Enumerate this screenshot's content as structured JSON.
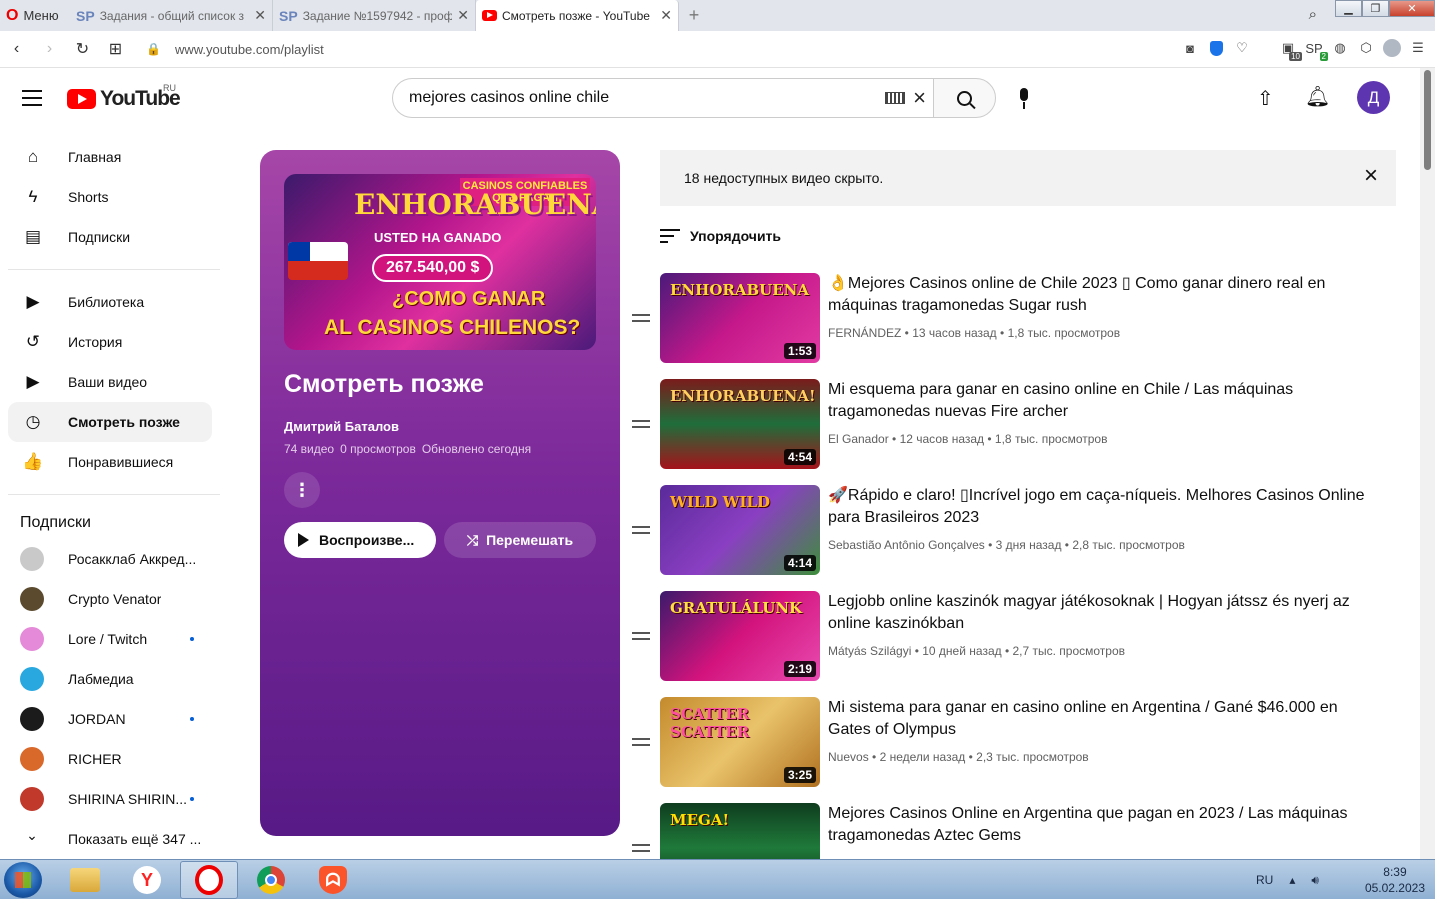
{
  "browser": {
    "menu_label": "Меню",
    "tabs": [
      {
        "title": "Задания - общий список з"
      },
      {
        "title": "Задание №1597942 - проф"
      },
      {
        "title": "Смотреть позже - YouTube"
      }
    ],
    "new_tab": "+",
    "url": "www.youtube.com/playlist",
    "ext_badges": {
      "a": "10",
      "b": "2"
    }
  },
  "youtube": {
    "logo_text": "YouTube",
    "country": "RU",
    "search_value": "mejores casinos online chile",
    "avatar_letter": "Д"
  },
  "sidebar": {
    "items": [
      {
        "label": "Главная",
        "icon": "⌂"
      },
      {
        "label": "Shorts",
        "icon": "ϟ"
      },
      {
        "label": "Подписки",
        "icon": "▤"
      }
    ],
    "items2": [
      {
        "label": "Библиотека",
        "icon": "▶"
      },
      {
        "label": "История",
        "icon": "↺"
      },
      {
        "label": "Ваши видео",
        "icon": "▶"
      },
      {
        "label": "Смотреть позже",
        "icon": "◷"
      },
      {
        "label": "Понравившиеся",
        "icon": "👍"
      }
    ],
    "subs_heading": "Подписки",
    "subscriptions": [
      {
        "name": "Росакклаб Аккред...",
        "color": "#c9c9c9",
        "dot": false
      },
      {
        "name": "Crypto Venator",
        "color": "#5b4a2e",
        "dot": false
      },
      {
        "name": "Lore / Twitch",
        "color": "#e48ad8",
        "dot": true
      },
      {
        "name": "Лабмедиа",
        "color": "#29a8e0",
        "dot": false
      },
      {
        "name": "JORDAN",
        "color": "#1b1b1b",
        "dot": true
      },
      {
        "name": "RICHER",
        "color": "#d9692b",
        "dot": false
      },
      {
        "name": "SHIRINA SHIRIN...",
        "color": "#c0392b",
        "dot": true
      }
    ],
    "show_more": "Показать ещё 347 ..."
  },
  "playlist": {
    "thumb_text": {
      "badge": "CASINOS CONFIABLES QUE PAGAN",
      "big": "ENHORABUENA",
      "won": "USTED HA GANADO",
      "amount": "267.540,00 $",
      "q1": "¿COMO GANAR",
      "q2": "AL CASINOS CHILENOS?"
    },
    "title": "Смотреть позже",
    "owner": "Дмитрий Баталов",
    "videos": "74 видео",
    "views": "0 просмотров",
    "updated": "Обновлено сегодня",
    "play_label": "Воспроизве...",
    "shuffle_label": "Перемешать"
  },
  "notice": "18 недоступных видео скрыто.",
  "sort_label": "Упорядочить",
  "videos": [
    {
      "title": "👌Mejores Casinos online de Chile 2023 ▯ Como ganar dinero real en máquinas tragamonedas Sugar rush",
      "channel": "FERNÁNDEZ",
      "age": "13 часов назад",
      "views": "1,8 тыс. просмотров",
      "duration": "1:53",
      "thumb": "linear-gradient(135deg,#4a1a7a,#c5188a 50%,#e23ba3)",
      "thumb_text": "ENHORABUENA",
      "thumb_color": "#ffd83a"
    },
    {
      "title": "Mi esquema para ganar en casino online en Chile / Las máquinas tragamonedas nuevas Fire archer",
      "channel": "El Ganador",
      "age": "12 часов назад",
      "views": "1,8 тыс. просмотров",
      "duration": "4:54",
      "thumb": "linear-gradient(180deg,#7b1b1b,#1f6e3b 50%,#a5121a)",
      "thumb_text": "ENHORABUENA!",
      "thumb_color": "#ffd060"
    },
    {
      "title": "🚀Rápido e claro! ▯Incrível jogo em caça-níqueis. Melhores Casinos Online para Brasileiros 2023",
      "channel": "Sebastião Antônio Gonçalves",
      "age": "3 дня назад",
      "views": "2,8 тыс. просмотров",
      "duration": "4:14",
      "thumb": "linear-gradient(135deg,#5a2a9a,#8a3fc2 50%,#3d8f3a)",
      "thumb_text": "WILD WILD",
      "thumb_color": "#ffb020"
    },
    {
      "title": "Legjobb online kaszinók magyar játékosoknak | Hogyan játssz és nyerj az online kaszinókban",
      "channel": "Mátyás Szilágyi",
      "age": "10 дней назад",
      "views": "2,7 тыс. просмотров",
      "duration": "2:19",
      "thumb": "linear-gradient(135deg,#3b1a6b,#d3137d 50%,#e84bb0)",
      "thumb_text": "GRATULÁLUNK",
      "thumb_color": "#ffe040"
    },
    {
      "title": "Mi sistema para ganar en casino online en Argentina / Gané $46.000 en Gates of Olympus",
      "channel": "Nuevos",
      "age": "2 недели назад",
      "views": "2,3 тыс. просмотров",
      "duration": "3:25",
      "thumb": "linear-gradient(135deg,#c48a2c,#e9c36a 50%,#b07020)",
      "thumb_text": "SCATTER SCATTER",
      "thumb_color": "#ff4fa0"
    },
    {
      "title": "Mejores Casinos Online en Argentina que pagan en 2023 / Las máquinas tragamonedas Aztec Gems",
      "channel": "",
      "age": "",
      "views": "",
      "duration": "",
      "thumb": "linear-gradient(180deg,#0f3d1f,#1f7a3a 50%,#0d2a14)",
      "thumb_text": "MEGA!",
      "thumb_color": "#ffe000"
    }
  ],
  "taskbar": {
    "lang": "RU",
    "time": "8:39",
    "date": "05.02.2023"
  }
}
